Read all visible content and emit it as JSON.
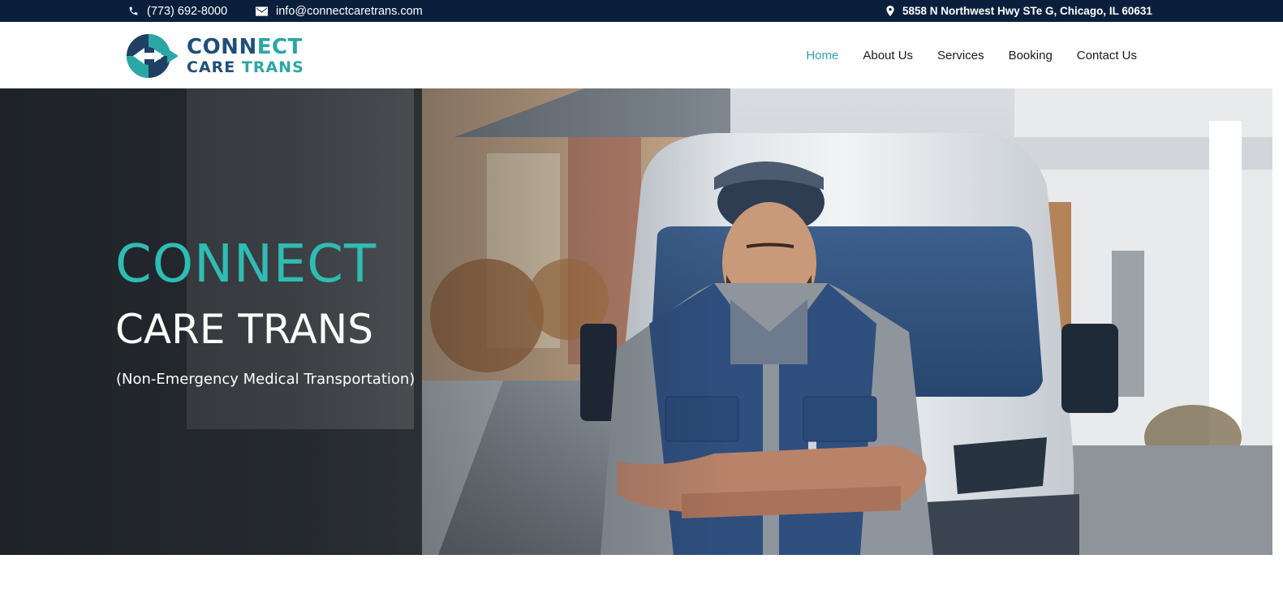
{
  "topbar": {
    "phone": "(773) 692-8000",
    "email": "info@connectcaretrans.com",
    "address": "5858 N Northwest Hwy STe G, Chicago, IL 60631",
    "icons": [
      "phone-icon",
      "envelope-icon",
      "map-pin-icon"
    ]
  },
  "logo": {
    "line1_part1": "CONN",
    "line1_accent": "ECT",
    "line2_part1": "CARE ",
    "line2_accent": "TRANS"
  },
  "nav": {
    "items": [
      {
        "label": "Home",
        "active": true
      },
      {
        "label": "About Us",
        "active": false
      },
      {
        "label": "Services",
        "active": false
      },
      {
        "label": "Booking",
        "active": false
      },
      {
        "label": "Contact Us",
        "active": false
      }
    ]
  },
  "hero": {
    "title_line1": "CONNECT",
    "title_line2": "CARE TRANS",
    "subtitle": "(Non-Emergency Medical Transportation)"
  },
  "colors": {
    "topbar_bg": "#0b1f3d",
    "accent_teal": "#2aa7a5",
    "brand_navy": "#1f4f78",
    "hero_title_teal": "#2fbcb4"
  }
}
